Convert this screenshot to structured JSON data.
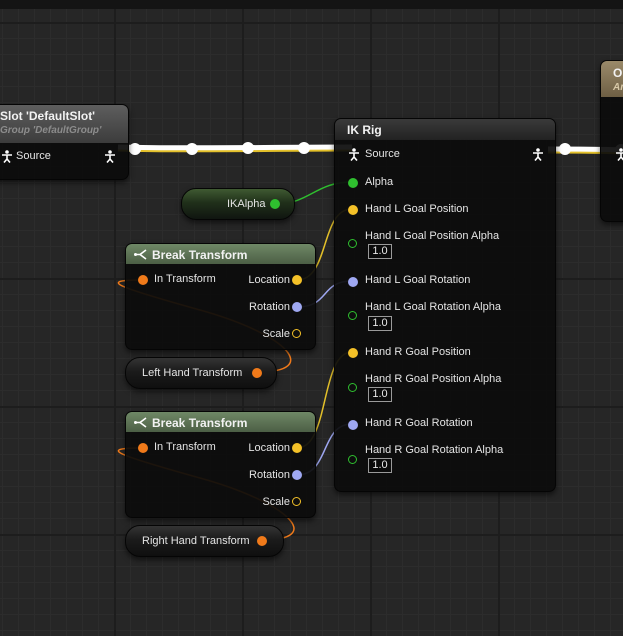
{
  "colors": {
    "exec_white": "#ffffff",
    "exec_yellow": "#e3c02a",
    "vector_pin": "#f4c128",
    "rotator_pin": "#9fa8f2",
    "float_pin": "#2fbf2f",
    "transform_pin": "#f07a1a",
    "ik_header": "#2a2a2a",
    "break_header": "#637a5a"
  },
  "slot_node": {
    "title": "Slot 'DefaultSlot'",
    "subtitle": "Group 'DefaultGroup'",
    "pin_label": "Source",
    "pin_icon": "pose-person-icon"
  },
  "output_node": {
    "title_fragment": "Ou",
    "subtitle_fragment": "An"
  },
  "ik_rig": {
    "title": "IK Rig",
    "source_label": "Source",
    "pins": [
      {
        "label": "Alpha"
      },
      {
        "label": "Hand L Goal Position"
      },
      {
        "label": "Hand L Goal Position Alpha",
        "value": "1.0"
      },
      {
        "label": "Hand L Goal Rotation"
      },
      {
        "label": "Hand L Goal Rotation Alpha",
        "value": "1.0"
      },
      {
        "label": "Hand R Goal Position"
      },
      {
        "label": "Hand R Goal Position Alpha",
        "value": "1.0"
      },
      {
        "label": "Hand R Goal Rotation"
      },
      {
        "label": "Hand R Goal Rotation Alpha",
        "value": "1.0"
      }
    ]
  },
  "ikalpha_var": {
    "label": "IKAlpha"
  },
  "break_transform_1": {
    "title": "Break Transform",
    "in_label": "In Transform",
    "location_label": "Location",
    "rotation_label": "Rotation",
    "scale_label": "Scale",
    "icon": "break-struct-icon"
  },
  "break_transform_2": {
    "title": "Break Transform",
    "in_label": "In Transform",
    "location_label": "Location",
    "rotation_label": "Rotation",
    "scale_label": "Scale",
    "icon": "break-struct-icon"
  },
  "left_hand_var": {
    "label": "Left Hand Transform"
  },
  "right_hand_var": {
    "label": "Right Hand Transform"
  }
}
